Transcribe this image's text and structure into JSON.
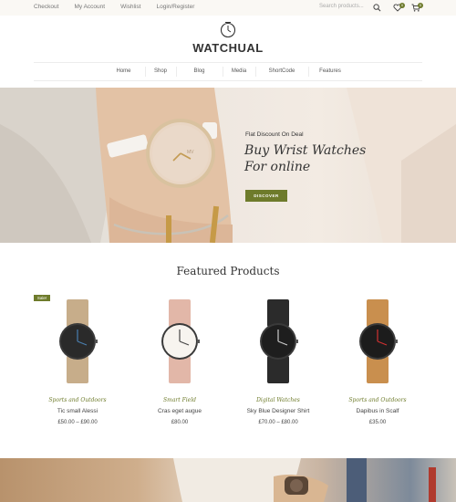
{
  "topbar": {
    "links": [
      "Checkout",
      "My Account",
      "Wishlist",
      "Login/Register"
    ],
    "search_placeholder": "Search products...",
    "wishlist_count": "0",
    "cart_count": "0"
  },
  "logo": {
    "text": "WATCHUAL"
  },
  "nav": {
    "items": [
      "Home",
      "Shop",
      "Blog",
      "Media",
      "ShortCode",
      "Features"
    ]
  },
  "hero": {
    "eyebrow": "Flat Discount On Deal",
    "title_line1": "Buy Wrist Watches",
    "title_line2": "For online",
    "button": "DISCOVER"
  },
  "featured": {
    "title": "Featured Products",
    "sale_label": "Sale!",
    "products": [
      {
        "category": "Sports and Outdoors",
        "name": "Tic small Alessi",
        "price": "£50.00 – £90.00",
        "strap": "#c7ad8a",
        "dial": "#2a2a2a",
        "hands": "#4a7fb0"
      },
      {
        "category": "Smart Field",
        "name": "Cras eget augue",
        "price": "£80.00",
        "strap": "#e2b7a8",
        "dial": "#f7f4ef",
        "hands": "#444444"
      },
      {
        "category": "Digital Watches",
        "name": "Sky Blue Designer Shirt",
        "price": "£70.00 – £80.00",
        "strap": "#2b2b2b",
        "dial": "#1e1e1e",
        "hands": "#cccccc"
      },
      {
        "category": "Sports and Outdoors",
        "name": "Dapibus in Scalf",
        "price": "£35.00",
        "strap": "#c98f4e",
        "dial": "#1c1c1c",
        "hands": "#d03030"
      }
    ]
  },
  "colors": {
    "accent": "#6e7b2b",
    "topbar_bg": "#faf8f4"
  }
}
